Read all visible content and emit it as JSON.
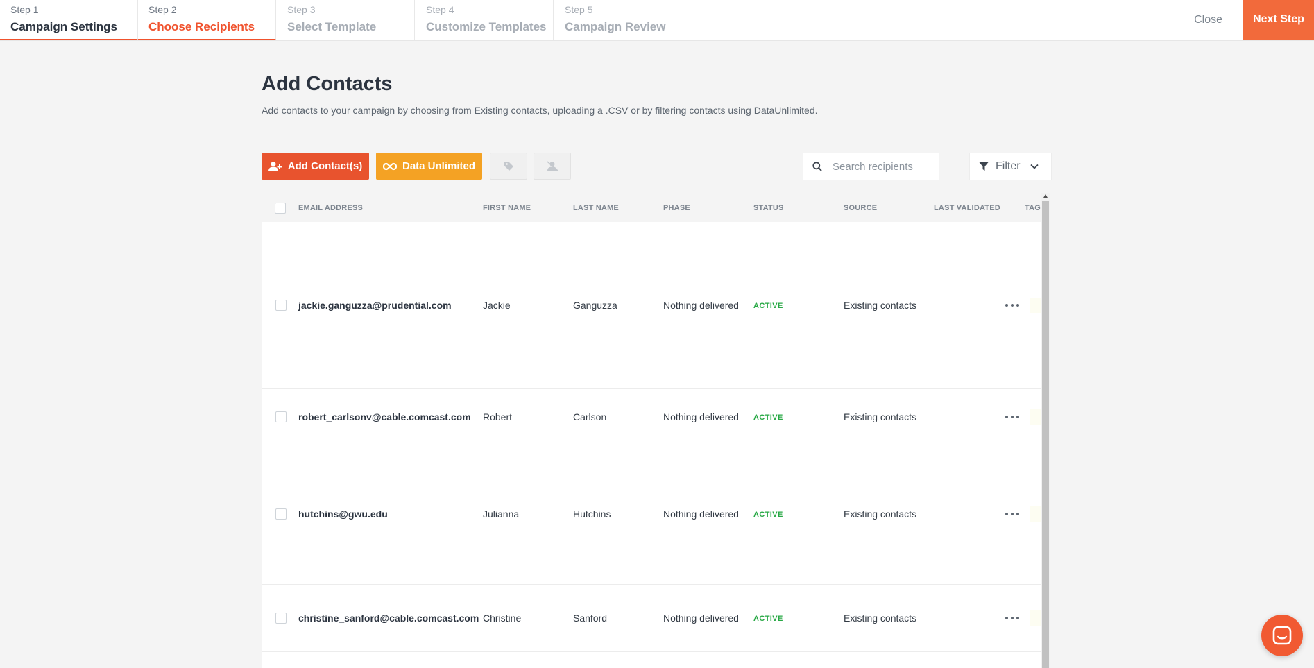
{
  "stepper": [
    {
      "num": "Step 1",
      "name": "Campaign Settings"
    },
    {
      "num": "Step 2",
      "name": "Choose Recipients"
    },
    {
      "num": "Step 3",
      "name": "Select Template"
    },
    {
      "num": "Step 4",
      "name": "Customize Templates"
    },
    {
      "num": "Step 5",
      "name": "Campaign Review"
    }
  ],
  "header": {
    "close_label": "Close",
    "next_label": "Next Step"
  },
  "page": {
    "title": "Add Contacts",
    "description": "Add contacts to your campaign by choosing from Existing contacts, uploading a .CSV or by filtering contacts using DataUnlimited."
  },
  "toolbar": {
    "add_contacts_label": "Add Contact(s)",
    "data_unlimited_label": "Data Unlimited",
    "search_placeholder": "Search recipients",
    "filter_label": "Filter"
  },
  "table": {
    "columns": [
      "EMAIL ADDRESS",
      "FIRST NAME",
      "LAST NAME",
      "PHASE",
      "STATUS",
      "SOURCE",
      "LAST VALIDATED",
      "TAG"
    ],
    "rows": [
      {
        "email": "jackie.ganguzza@prudential.com",
        "first": "Jackie",
        "last": "Ganguzza",
        "phase": "Nothing delivered",
        "status": "ACTIVE",
        "source": "Existing contacts"
      },
      {
        "email": "robert_carlsonv@cable.comcast.com",
        "first": "Robert",
        "last": "Carlson",
        "phase": "Nothing delivered",
        "status": "ACTIVE",
        "source": "Existing contacts"
      },
      {
        "email": "hutchins@gwu.edu",
        "first": "Julianna",
        "last": "Hutchins",
        "phase": "Nothing delivered",
        "status": "ACTIVE",
        "source": "Existing contacts"
      },
      {
        "email": "christine_sanford@cable.comcast.com",
        "first": "Christine",
        "last": "Sanford",
        "phase": "Nothing delivered",
        "status": "ACTIVE",
        "source": "Existing contacts"
      }
    ]
  },
  "colors": {
    "accent": "#f0522d",
    "next_step": "#f26a3b",
    "data_unlimited": "#f4a224",
    "status_active": "#27a844"
  },
  "icons": [
    "add-user-icon",
    "infinity-icon",
    "tag-icon",
    "remove-user-icon",
    "search-icon",
    "filter-icon",
    "chevron-down-icon",
    "more-options-icon",
    "chat-icon"
  ]
}
